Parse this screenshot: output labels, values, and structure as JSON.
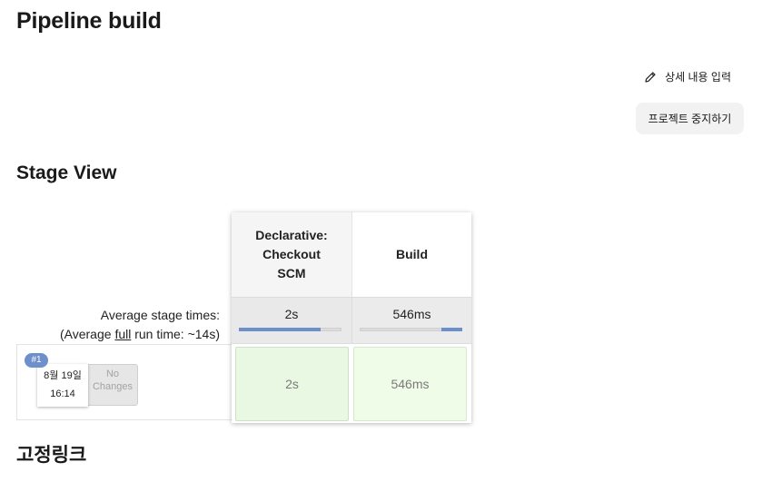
{
  "page": {
    "title": "Pipeline build"
  },
  "actions": {
    "edit_description_label": "상세 내용 입력",
    "edit_icon": "pencil-icon",
    "stop_project_label": "프로젝트 중지하기"
  },
  "stage_view": {
    "title": "Stage View",
    "stages": [
      {
        "name": "Declarative: Checkout SCM",
        "name_lines": [
          "Declarative:",
          "Checkout",
          "SCM"
        ],
        "avg_time": "2s",
        "avg_fraction": 0.8
      },
      {
        "name": "Build",
        "name_lines": [
          "Build"
        ],
        "avg_time": "546ms",
        "avg_fraction": 0.2
      }
    ],
    "avg_label": "Average stage times:",
    "avg_full_prefix": "(Average ",
    "avg_full_word": "full",
    "avg_full_suffix": " run time: ~14s)",
    "runs": [
      {
        "badge": "#1",
        "date": "8월 19일",
        "time": "16:14",
        "changes_line1": "No",
        "changes_line2": "Changes",
        "stage_times": [
          "2s",
          "546ms"
        ],
        "status_color": "#e9f8e3"
      }
    ]
  },
  "permalinks": {
    "title": "고정링크"
  }
}
